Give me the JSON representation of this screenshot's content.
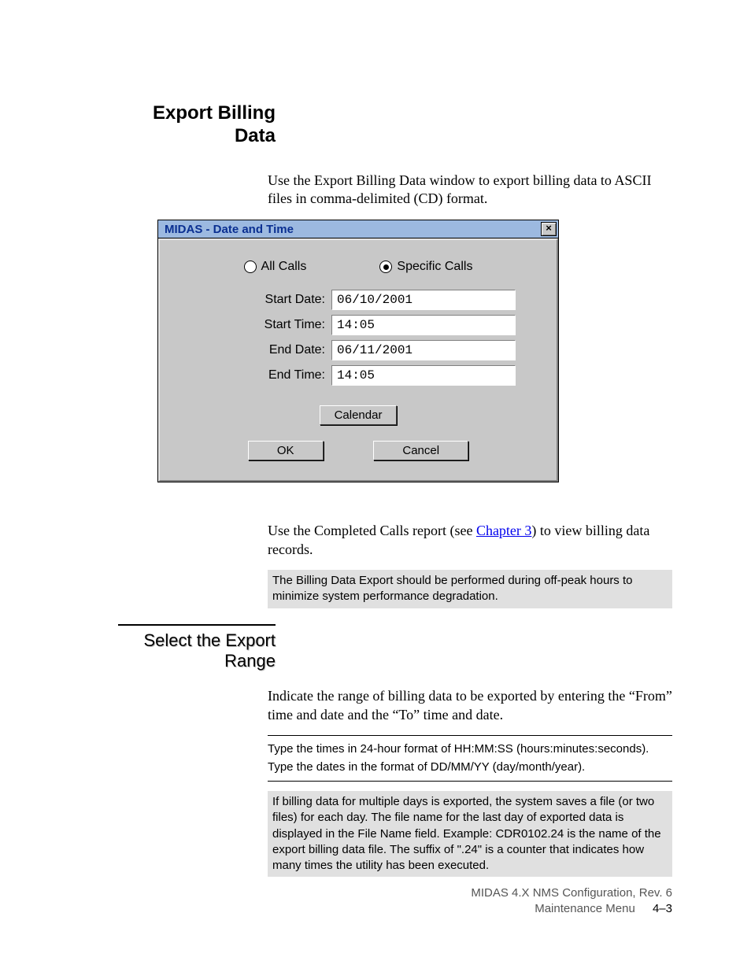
{
  "heading1": "Export Billing Data",
  "intro": "Use the Export Billing Data window to export billing data to ASCII files in comma-delimited (CD) format.",
  "dialog": {
    "title": "MIDAS - Date and Time",
    "close": "×",
    "radios": {
      "all": "All Calls",
      "specific": "Specific Calls"
    },
    "labels": {
      "start_date": "Start Date:",
      "start_time": "Start Time:",
      "end_date": "End Date:",
      "end_time": "End Time:"
    },
    "values": {
      "start_date": "06/10/2001",
      "start_time": "14:05",
      "end_date": "06/11/2001",
      "end_time": "14:05"
    },
    "buttons": {
      "calendar": "Calendar",
      "ok": "OK",
      "cancel": "Cancel"
    }
  },
  "after": {
    "para1_a": "Use the Completed Calls report (see ",
    "para1_link": "Chapter 3",
    "para1_b": ") to view billing data records.",
    "note1": "The Billing Data Export should be performed during off-peak hours to minimize system performance degradation."
  },
  "heading2": "Select the Export Range",
  "range": {
    "para": "Indicate the range of billing data to be exported by entering the “From” time and date and the “To” time and date.",
    "tip1": "Type the times in 24-hour format of HH:MM:SS (hours:minutes:seconds).",
    "tip2": "Type the dates in the format of DD/MM/YY (day/month/year).",
    "note2": "If billing data for multiple days is exported, the system saves a file (or two files) for each day. The file name for the last day of exported data is displayed in the File Name field. Example: CDR0102.24 is the name of the export billing data file. The suffix of \".24\" is a counter that indicates how many times the utility has been executed."
  },
  "footer": {
    "line1": "MIDAS 4.X  NMS Configuration, Rev. 6",
    "line2a": "Maintenance Menu",
    "line2b": "4–3"
  }
}
